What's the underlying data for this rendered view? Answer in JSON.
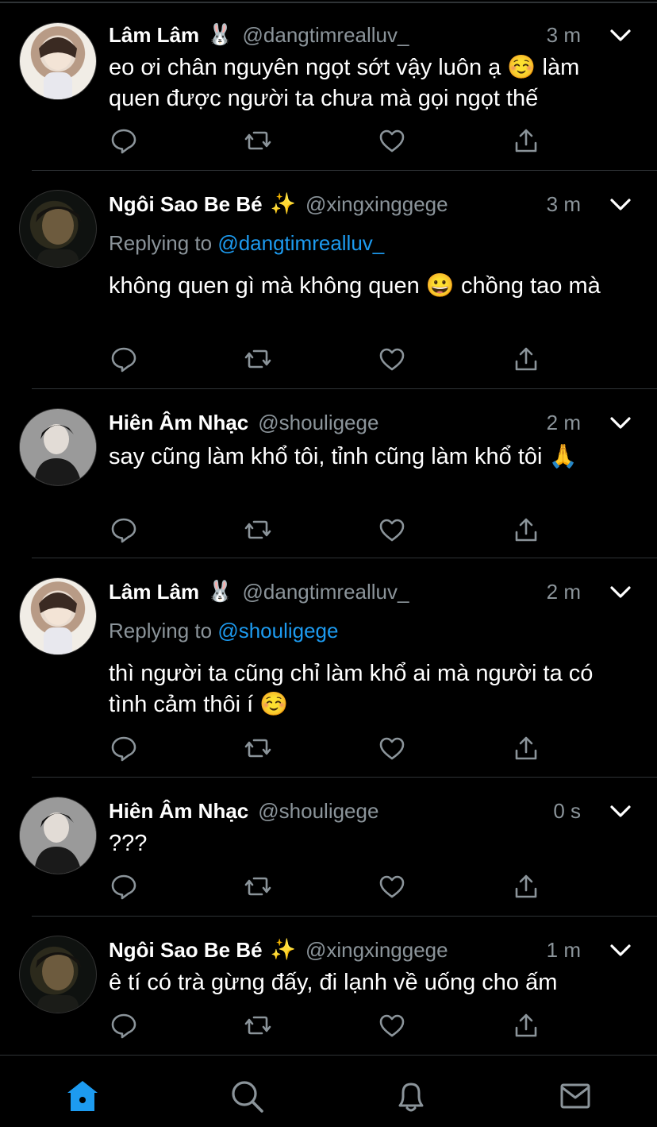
{
  "colors": {
    "accent": "#1d9bf0",
    "muted": "#8b949a",
    "divider": "#2f3336",
    "background": "#000000"
  },
  "tweets": [
    {
      "name": "Lâm Lâm",
      "name_emoji": "🐰",
      "handle": "@dangtimrealluv_",
      "time": "3 m",
      "reply_to": "",
      "body": "eo ơi chân nguyên ngọt sớt vậy luôn ạ ☺️ làm quen được người ta chưa mà gọi ngọt thế",
      "avatar": "avatar-lam"
    },
    {
      "name": "Ngôi Sao Be Bé",
      "name_emoji": "✨",
      "handle": "@xingxinggege",
      "time": "3 m",
      "reply_prefix": "Replying to",
      "reply_to": "@dangtimrealluv_",
      "body": "không quen gì mà không quen 😀 chồng tao mà",
      "avatar": "avatar-sao"
    },
    {
      "name": "Hiên Âm Nhạc",
      "name_emoji": "",
      "handle": "@shouligege",
      "time": "2 m",
      "reply_to": "",
      "body": "say cũng làm khổ tôi, tỉnh cũng làm khổ tôi 🙏",
      "avatar": "avatar-hien"
    },
    {
      "name": "Lâm Lâm",
      "name_emoji": "🐰",
      "handle": "@dangtimrealluv_",
      "time": "2 m",
      "reply_prefix": "Replying to",
      "reply_to": "@shouligege",
      "body": "thì người ta cũng chỉ làm khổ ai mà người ta có tình cảm thôi í ☺️",
      "avatar": "avatar-lam"
    },
    {
      "name": "Hiên Âm Nhạc",
      "name_emoji": "",
      "handle": "@shouligege",
      "time": "0 s",
      "reply_to": "",
      "body": "???",
      "avatar": "avatar-hien"
    },
    {
      "name": "Ngôi Sao Be Bé",
      "name_emoji": "✨",
      "handle": "@xingxinggege",
      "time": "1 m",
      "reply_to": "",
      "body": "ê tí có trà gừng đấy, đi lạnh về uống cho ấm",
      "avatar": "avatar-sao"
    }
  ],
  "icons": {
    "reply": "reply-icon",
    "retweet": "retweet-icon",
    "like": "heart-icon",
    "share": "share-icon",
    "more": "chevron-down-icon"
  },
  "tabbar": {
    "tabs": [
      "home-icon",
      "search-icon",
      "notifications-icon",
      "messages-icon"
    ],
    "active": "home-icon"
  }
}
